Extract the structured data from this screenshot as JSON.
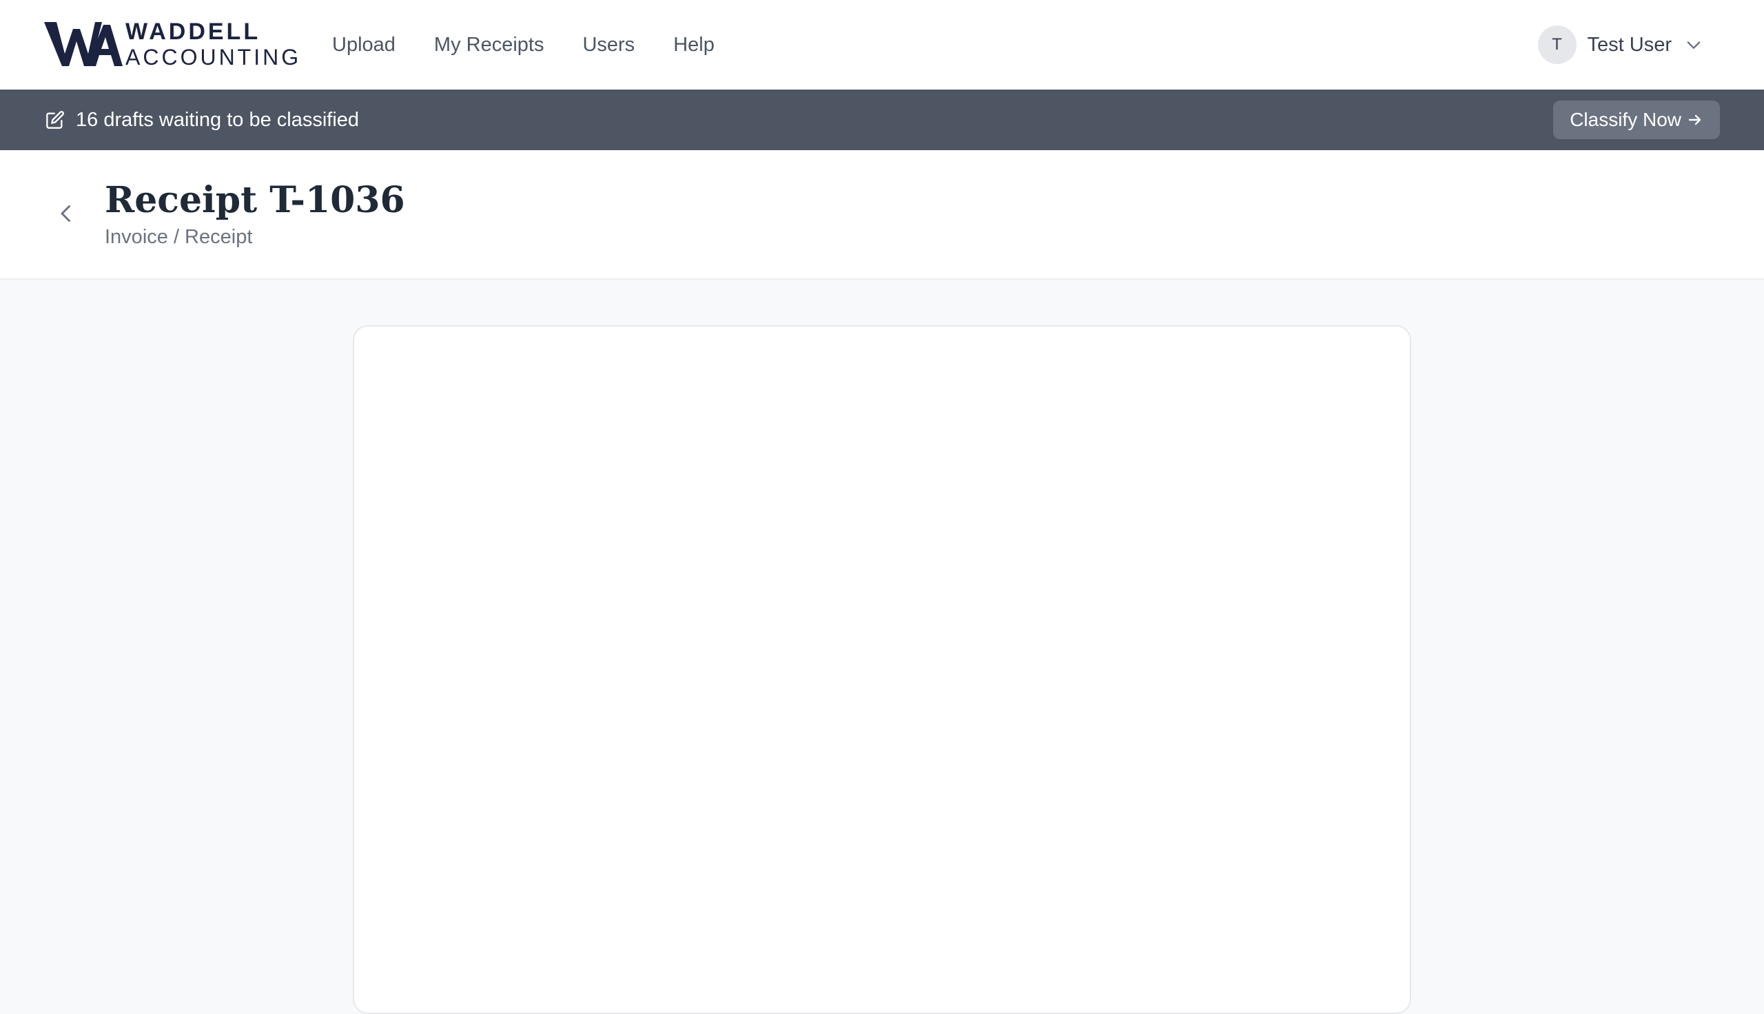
{
  "brand": {
    "line1": "WADDELL",
    "line2": "ACCOUNTING",
    "mark_icon": "wa-monogram-logo",
    "color": "#1b2340"
  },
  "nav": {
    "items": [
      {
        "label": "Upload"
      },
      {
        "label": "My Receipts"
      },
      {
        "label": "Users"
      },
      {
        "label": "Help"
      }
    ]
  },
  "user": {
    "initial": "T",
    "name": "Test User",
    "menu_icon": "chevron-down-icon"
  },
  "banner": {
    "icon": "edit-icon",
    "message": "16 drafts waiting to be classified",
    "action_label": "Classify Now",
    "action_icon": "arrow-right-icon",
    "background": "#4e5563"
  },
  "page": {
    "back_icon": "chevron-left-icon",
    "title": "Receipt T-1036",
    "subtitle": "Invoice / Receipt"
  }
}
